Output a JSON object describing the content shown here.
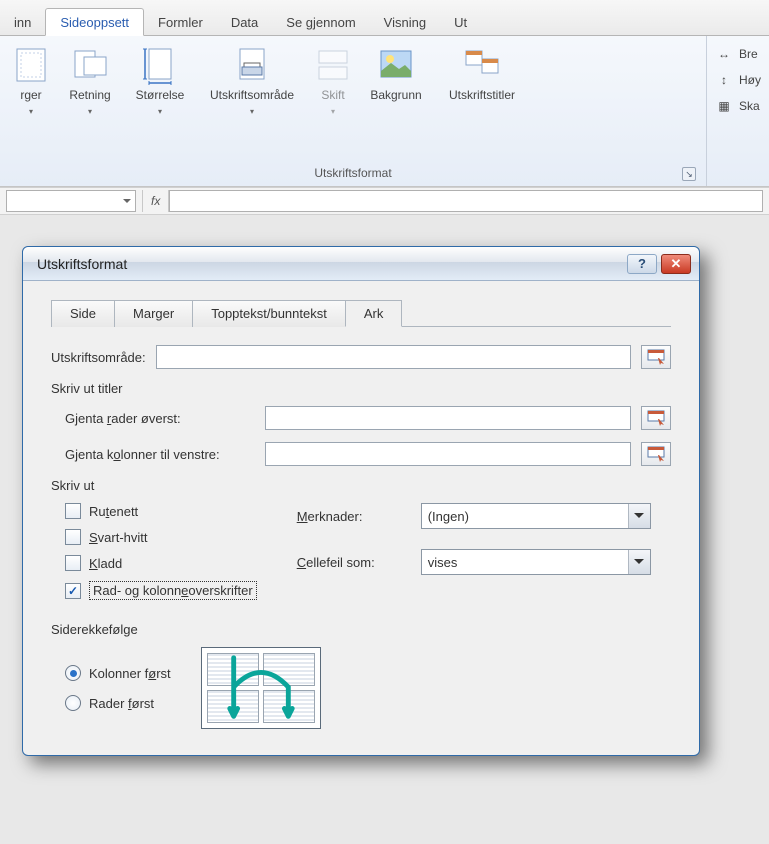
{
  "ribbon": {
    "tabs": [
      "inn",
      "Sideoppsett",
      "Formler",
      "Data",
      "Se gjennom",
      "Visning",
      "Ut"
    ],
    "active_tab": 1,
    "buttons": {
      "margins": "rger",
      "orientation": "Retning",
      "size": "Størrelse",
      "print_area": "Utskriftsområde",
      "breaks": "Skift",
      "background": "Bakgrunn",
      "print_titles": "Utskriftstitler"
    },
    "group_label": "Utskriftsformat",
    "side": {
      "width": "Bre",
      "height": "Høy",
      "scale": "Ska"
    }
  },
  "formula_bar": {
    "fx": "fx"
  },
  "dialog": {
    "title": "Utskriftsformat",
    "tabs": [
      "Side",
      "Marger",
      "Topptekst/bunntekst",
      "Ark"
    ],
    "active_tab": 3,
    "labels": {
      "print_area": "Utskriftsområde:",
      "print_titles": "Skriv ut titler",
      "repeat_rows": "Gjenta rader øverst:",
      "repeat_cols": "Gjenta kolonner til venstre:",
      "print": "Skriv ut",
      "gridlines": "Rutenett",
      "bw": "Svart-hvitt",
      "draft": "Kladd",
      "headings": "Rad- og kolonneoverskrifter",
      "comments": "Merknader:",
      "cell_errors": "Cellefeil som:",
      "page_order": "Siderekkefølge",
      "down_then_over": "Kolonner først",
      "over_then_down": "Rader først"
    },
    "values": {
      "print_area": "",
      "repeat_rows": "",
      "repeat_cols": "",
      "comments": "(Ingen)",
      "cell_errors": "vises",
      "gridlines": false,
      "bw": false,
      "draft": false,
      "headings": true,
      "order": "down_then_over"
    }
  }
}
